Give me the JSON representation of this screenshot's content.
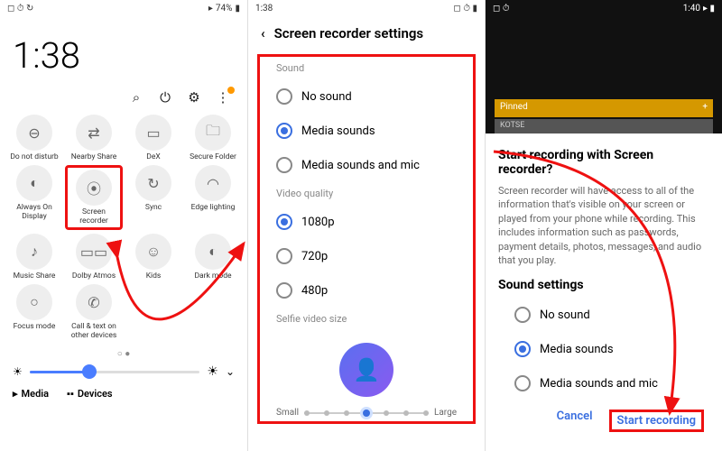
{
  "p1": {
    "status": {
      "battery": "74%",
      "time": "1:38"
    },
    "clock": "1:38",
    "toolbar": {
      "search": "⌕",
      "power": "⏻",
      "settings": "⚙",
      "more": "⋮"
    },
    "tiles": [
      {
        "icon": "⊖",
        "label": "Do not disturb"
      },
      {
        "icon": "⇄",
        "label": "Nearby Share"
      },
      {
        "icon": "▭",
        "label": "DeX"
      },
      {
        "icon": "🗀",
        "label": "Secure Folder"
      },
      {
        "icon": "◐",
        "label": "Always On Display"
      },
      {
        "icon": "⦿",
        "label": "Screen recorder"
      },
      {
        "icon": "↻",
        "label": "Sync"
      },
      {
        "icon": "◠",
        "label": "Edge lighting"
      },
      {
        "icon": "♪",
        "label": "Music Share"
      },
      {
        "icon": "▭▭",
        "label": "Dolby Atmos"
      },
      {
        "icon": "☺",
        "label": "Kids"
      },
      {
        "icon": "◐",
        "label": "Dark mode"
      },
      {
        "icon": "○",
        "label": "Focus mode"
      },
      {
        "icon": "✆",
        "label": "Call & text on other devices"
      }
    ],
    "tabs": {
      "media": "Media",
      "devices": "Devices"
    }
  },
  "p2": {
    "status": {
      "time": "1:38"
    },
    "title": "Screen recorder settings",
    "sound_label": "Sound",
    "sound_opts": [
      "No sound",
      "Media sounds",
      "Media sounds and mic"
    ],
    "sound_sel": 1,
    "video_label": "Video quality",
    "video_opts": [
      "1080p",
      "720p",
      "480p"
    ],
    "video_sel": 0,
    "selfie_label": "Selfie video size",
    "slider": {
      "small": "Small",
      "large": "Large"
    }
  },
  "p3": {
    "status": {
      "time": "1:40"
    },
    "pinned": "Pinned",
    "kotse": "KOTSE",
    "dlg_title": "Start recording with Screen recorder?",
    "dlg_body": "Screen recorder will have access to all of the information that's visible on your screen or played from your phone while recording. This includes information such as passwords, payment details, photos, messages, and audio that you play.",
    "sound_title": "Sound settings",
    "sound_opts": [
      "No sound",
      "Media sounds",
      "Media sounds and mic"
    ],
    "sound_sel": 1,
    "cancel": "Cancel",
    "start": "Start recording"
  }
}
